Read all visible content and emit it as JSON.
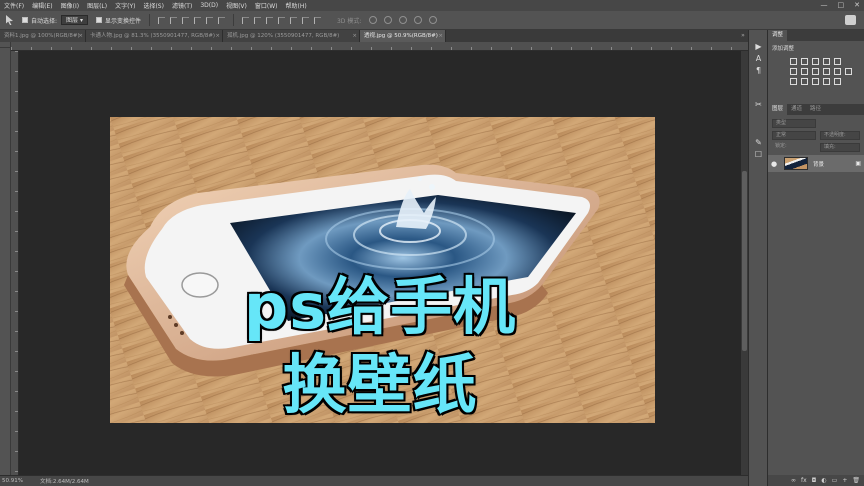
{
  "menu": [
    "文件(F)",
    "编辑(E)",
    "图像(I)",
    "图层(L)",
    "文字(Y)",
    "选择(S)",
    "滤镜(T)",
    "3D(D)",
    "视图(V)",
    "窗口(W)",
    "帮助(H)"
  ],
  "window_controls": [
    "—",
    "□",
    "✕"
  ],
  "options": {
    "auto_select_label": "自动选择:",
    "auto_select_value": "图层",
    "show_transform_label": "显示变换控件",
    "mode_3d_label": "3D 模式:"
  },
  "tabs": [
    {
      "label": "资料1.jpg @ 100%(RGB/8#)",
      "close": "×",
      "active": false
    },
    {
      "label": "卡通人物.jpg @ 81.3% (3550901477, RGB/8#)",
      "close": "×",
      "active": false
    },
    {
      "label": "孤机.jpg @ 120% (3550901477, RGB/8#)",
      "close": "×",
      "active": false
    },
    {
      "label": "透视.jpg @ 50.9%(RGB/8#)",
      "close": "×",
      "active": true
    }
  ],
  "tab_overflow": "»",
  "canvas": {
    "overlay_line1": "ps给手机",
    "overlay_line2": "换壁纸",
    "overlay_color": "#66e6f8"
  },
  "status": {
    "zoom": "50.91%",
    "doc": "文档:2.64M/2.64M"
  },
  "panels": {
    "adjust_tab": "调整",
    "adjust_label": "添加调整",
    "layers_tabs": [
      "图层",
      "通道",
      "路径"
    ],
    "filter_kind": "类型",
    "blend_mode": "正常",
    "opacity": "不透明度:",
    "lock": "锁定:",
    "fill": "填充:",
    "layer_name": "背景",
    "layer_visible_icon": "eye-icon",
    "layer_lock_icon": "lock-icon"
  }
}
